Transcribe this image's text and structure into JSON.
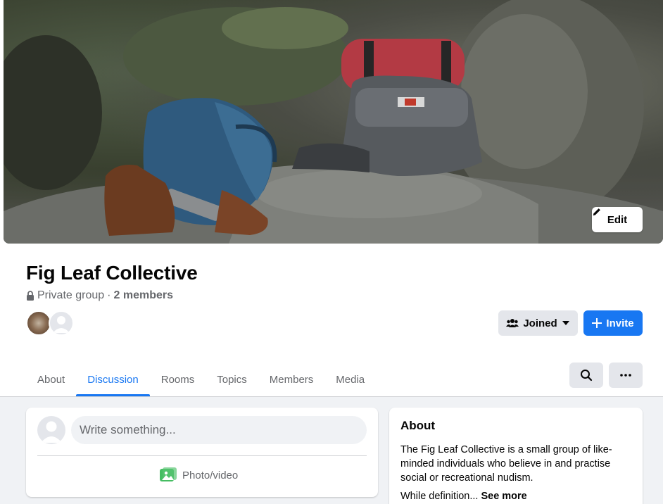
{
  "cover": {
    "edit_label": "Edit"
  },
  "group": {
    "name": "Fig Leaf Collective",
    "privacy": "Private group",
    "separator": "·",
    "members_count": "2 members"
  },
  "actions": {
    "joined_label": "Joined",
    "invite_label": "Invite"
  },
  "tabs": [
    {
      "label": "About"
    },
    {
      "label": "Discussion"
    },
    {
      "label": "Rooms"
    },
    {
      "label": "Topics"
    },
    {
      "label": "Members"
    },
    {
      "label": "Media"
    }
  ],
  "active_tab": "Discussion",
  "composer": {
    "placeholder": "Write something...",
    "photo_video_label": "Photo/video"
  },
  "about": {
    "heading": "About",
    "description": "The Fig Leaf Collective is a small group of like-minded individuals who believe in and practise social or recreational nudism.",
    "truncated": "While definition...",
    "see_more": "See more"
  },
  "colors": {
    "accent": "#1877f2",
    "secondary_button": "#e4e6eb",
    "feed_bg": "#f0f2f5",
    "muted_text": "#65676b"
  }
}
